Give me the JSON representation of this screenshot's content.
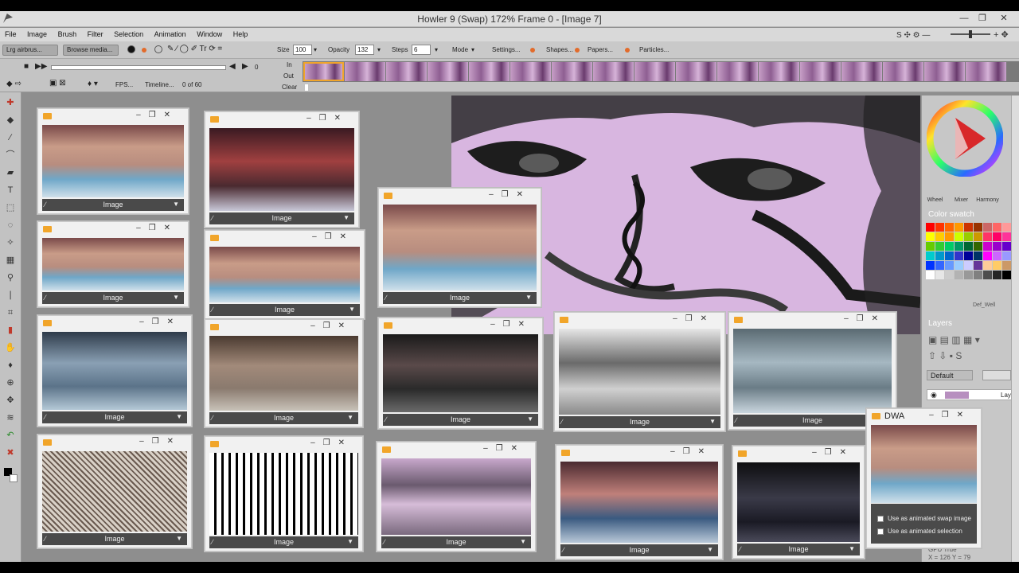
{
  "window": {
    "title": "Howler 9  (Swap)   172%  Frame  0   - [Image 7]",
    "min": "—",
    "max": "❐",
    "close": "✕"
  },
  "menu": [
    "File",
    "Image",
    "Brush",
    "Filter",
    "Selection",
    "Animation",
    "Window",
    "Help"
  ],
  "toolbar": {
    "brush_preset": "Lrg airbrus...",
    "browse_media": "Browse media...",
    "size_label": "Size",
    "size_value": "100",
    "opacity_label": "Opacity",
    "opacity_value": "132",
    "steps_label": "Steps",
    "steps_value": "6",
    "mode_label": "Mode",
    "settings": "Settings...",
    "shapes": "Shapes...",
    "papers": "Papers...",
    "particles": "Particles..."
  },
  "animation": {
    "in_label": "In",
    "out_label": "Out",
    "clear_label": "Clear",
    "frame_index": "0",
    "fps_label": "FPS...",
    "timeline_label": "Timeline...",
    "frame_count": "0 of 60",
    "frame_total_cells": 17
  },
  "right_panel": {
    "wheel_tabs": [
      "Wheel",
      "Mixer",
      "Harmony"
    ],
    "color_swatch_title": "Color swatch",
    "swatch_name": "Def_Well",
    "layers_title": "Layers",
    "layers_mode": "Default",
    "layer_name": "Laye",
    "gpu_status": "GPU True",
    "coords": "X = 126  Y = 79",
    "swatch_colors": [
      "#ff0000",
      "#ff3300",
      "#ff6600",
      "#ff9900",
      "#cc3300",
      "#993300",
      "#cc6666",
      "#ff6666",
      "#ff9999",
      "#ffff00",
      "#ffcc00",
      "#ff9900",
      "#ccff00",
      "#99cc00",
      "#cc9900",
      "#ff3366",
      "#ff0066",
      "#ff3399",
      "#66cc00",
      "#33cc33",
      "#00cc66",
      "#009966",
      "#006633",
      "#336600",
      "#cc00cc",
      "#9900cc",
      "#6600cc",
      "#00cccc",
      "#0099cc",
      "#0066cc",
      "#3333cc",
      "#000099",
      "#003366",
      "#ff00ff",
      "#cc66ff",
      "#9999ff",
      "#0033ff",
      "#3366ff",
      "#6699ff",
      "#99ccff",
      "#ccccff",
      "#663399",
      "#ffcc99",
      "#ffcc66",
      "#cc9966",
      "#ffffff",
      "#e6e6e6",
      "#cccccc",
      "#b3b3b3",
      "#999999",
      "#808080",
      "#4d4d4d",
      "#262626",
      "#000000"
    ]
  },
  "image_window_label": "Image",
  "dwa": {
    "title": "DWA",
    "swap_check": "Use as animated swap image",
    "selection_check": "Use as animated selection"
  }
}
